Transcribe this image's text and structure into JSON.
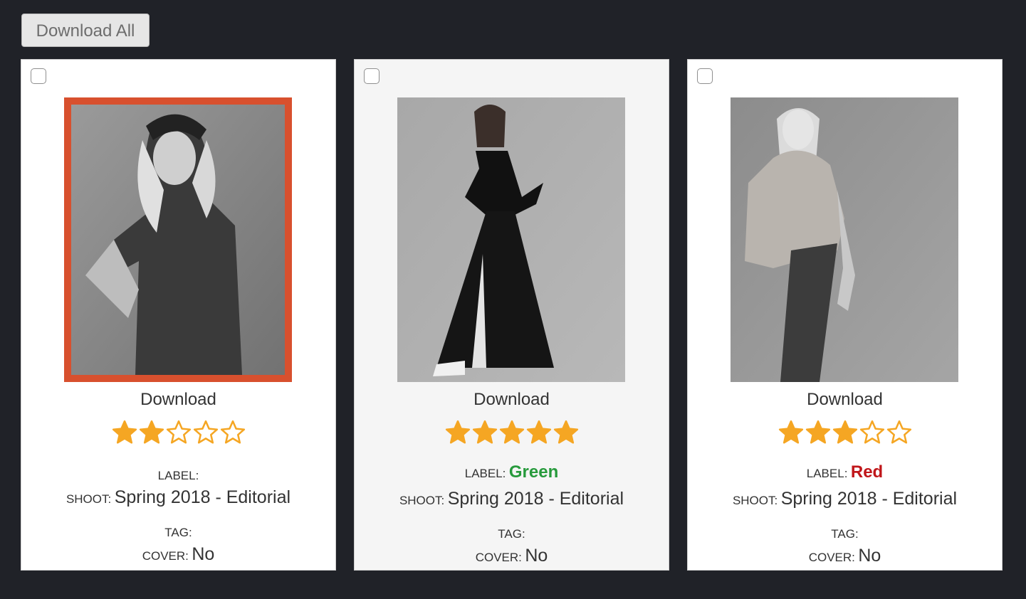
{
  "toolbar": {
    "download_all_label": "Download All"
  },
  "colors": {
    "background": "#202228",
    "selected_border": "#d8502e",
    "star": "#f5a623",
    "label_green": "#279a3c",
    "label_red": "#c0161a"
  },
  "field_keys": {
    "label": "LABEL:",
    "shoot": "SHOOT:",
    "tag": "TAG:",
    "cover": "COVER:"
  },
  "cards": [
    {
      "selected_frame": true,
      "download_label": "Download",
      "rating": 2,
      "rating_max": 5,
      "label_value": "",
      "shoot_value": "Spring 2018 - Editorial",
      "tag_value": "",
      "cover_value": "No"
    },
    {
      "selected_frame": false,
      "download_label": "Download",
      "rating": 5,
      "rating_max": 5,
      "label_value": "Green",
      "shoot_value": "Spring 2018 - Editorial",
      "tag_value": "",
      "cover_value": "No"
    },
    {
      "selected_frame": false,
      "download_label": "Download",
      "rating": 3,
      "rating_max": 5,
      "label_value": "Red",
      "shoot_value": "Spring 2018 - Editorial",
      "tag_value": "",
      "cover_value": "No"
    }
  ]
}
